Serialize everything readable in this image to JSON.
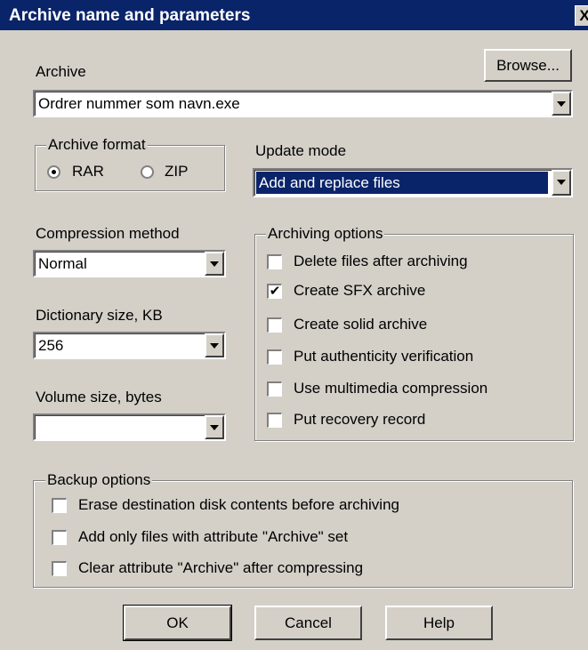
{
  "window": {
    "title": "Archive name and parameters",
    "close_glyph": "X"
  },
  "archive": {
    "label": "Archive",
    "value": "Ordrer nummer som navn.exe",
    "browse_label": "Browse..."
  },
  "archive_format": {
    "title": "Archive format",
    "options": [
      {
        "label": "RAR",
        "selected": true
      },
      {
        "label": "ZIP",
        "selected": false
      }
    ]
  },
  "update_mode": {
    "label": "Update mode",
    "value": "Add and replace files"
  },
  "compression_method": {
    "label": "Compression method",
    "value": "Normal"
  },
  "dictionary_size": {
    "label": "Dictionary size, KB",
    "value": "256"
  },
  "volume_size": {
    "label": "Volume size, bytes",
    "value": ""
  },
  "archiving_options": {
    "title": "Archiving options",
    "items": [
      {
        "label": "Delete files after archiving",
        "checked": false
      },
      {
        "label": "Create SFX archive",
        "checked": true
      },
      {
        "label": "Create solid archive",
        "checked": false
      },
      {
        "label": "Put authenticity verification",
        "checked": false
      },
      {
        "label": "Use multimedia compression",
        "checked": false
      },
      {
        "label": "Put recovery record",
        "checked": false
      }
    ]
  },
  "backup_options": {
    "title": "Backup options",
    "items": [
      {
        "label": "Erase destination disk contents before archiving",
        "checked": false
      },
      {
        "label": "Add only files with attribute \"Archive\" set",
        "checked": false
      },
      {
        "label": "Clear attribute \"Archive\" after compressing",
        "checked": false
      }
    ]
  },
  "buttons": {
    "ok": "OK",
    "cancel": "Cancel",
    "help": "Help"
  },
  "colors": {
    "titlebar": "#0a246a",
    "face": "#d4d0c8",
    "selection": "#0a246a"
  },
  "icons": {
    "check": "✔",
    "dropdown": "chevron-down-icon"
  }
}
